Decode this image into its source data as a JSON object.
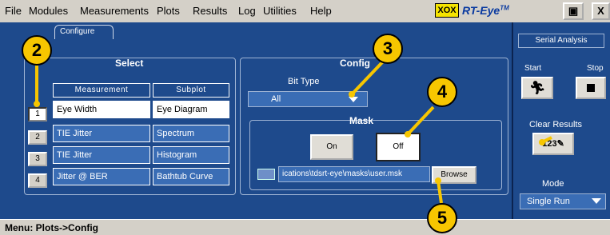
{
  "menu": [
    "File",
    "Modules",
    "Measurements",
    "Plots",
    "Results",
    "Log",
    "Utilities",
    "Help"
  ],
  "brand": {
    "logo": "XOX",
    "name": "RT-Eye",
    "tm": "TM"
  },
  "window_buttons": [
    "▣",
    "X"
  ],
  "tab_label": "Configure",
  "select": {
    "title": "Select",
    "headers": [
      "Measurement",
      "Subplot"
    ],
    "rows": [
      {
        "num": "1",
        "measurement": "Eye Width",
        "subplot": "Eye Diagram"
      },
      {
        "num": "2",
        "measurement": "TIE Jitter",
        "subplot": "Spectrum"
      },
      {
        "num": "3",
        "measurement": "TIE Jitter",
        "subplot": "Histogram"
      },
      {
        "num": "4",
        "measurement": "Jitter @ BER",
        "subplot": "Bathtub Curve"
      }
    ]
  },
  "config": {
    "title": "Config",
    "bit_type_label": "Bit Type",
    "bit_type_value": "All",
    "mask_label": "Mask",
    "on_label": "On",
    "off_label": "Off",
    "mask_path": "ications\\tdsrt-eye\\masks\\user.msk",
    "browse_label": "Browse"
  },
  "serial": {
    "title": "Serial Analysis",
    "start_label": "Start",
    "stop_label": "Stop",
    "clear_label": "Clear Results",
    "clear_icon_text": "123",
    "mode_label": "Mode",
    "mode_value": "Single Run"
  },
  "status": "Menu: Plots->Config",
  "callouts": [
    "2",
    "3",
    "4",
    "5"
  ],
  "colors": {
    "panel": "#1e4a8c",
    "cell": "#3a6db5",
    "callout": "#f7c600"
  }
}
